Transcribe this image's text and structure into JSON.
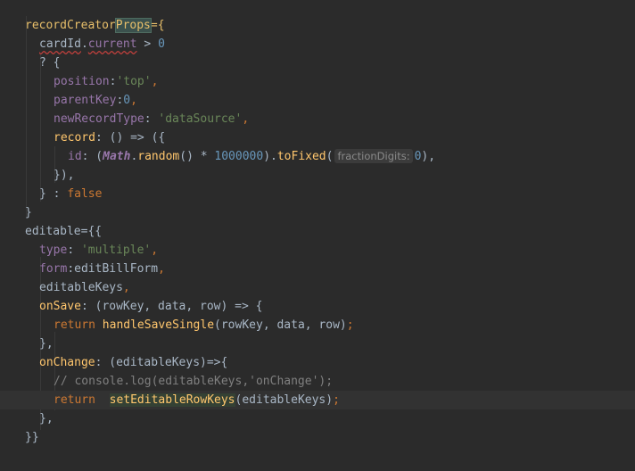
{
  "editor": {
    "colors": {
      "background": "#2b2b2b",
      "default": "#a9b7c6",
      "prop": "#9876aa",
      "string": "#6a8759",
      "number": "#6897bb",
      "keyword": "#cc7832",
      "function": "#ffc66d",
      "comment": "#808080",
      "tag": "#e8bf6a",
      "current_line": "#323232"
    },
    "lines": [
      {
        "indent": 1,
        "tokens": [
          {
            "t": "recordCreator",
            "s": "tag"
          },
          {
            "t": "Props",
            "s": "tag",
            "hl": "match"
          },
          {
            "t": "={",
            "s": "tag"
          }
        ]
      },
      {
        "indent": 2,
        "tokens": [
          {
            "t": "cardId",
            "s": "def",
            "ul": true
          },
          {
            "t": ".",
            "s": "def"
          },
          {
            "t": "current",
            "s": "prop",
            "ul": true
          },
          {
            "t": " > ",
            "s": "def"
          },
          {
            "t": "0",
            "s": "num"
          }
        ]
      },
      {
        "indent": 2,
        "tokens": [
          {
            "t": "? {",
            "s": "def"
          }
        ]
      },
      {
        "indent": 3,
        "tokens": [
          {
            "t": "position",
            "s": "prop"
          },
          {
            "t": ":",
            "s": "def"
          },
          {
            "t": "'top'",
            "s": "str"
          },
          {
            "t": ",",
            "s": "kw"
          }
        ]
      },
      {
        "indent": 3,
        "tokens": [
          {
            "t": "parentKey",
            "s": "prop"
          },
          {
            "t": ":",
            "s": "def"
          },
          {
            "t": "0",
            "s": "num"
          },
          {
            "t": ",",
            "s": "kw"
          }
        ]
      },
      {
        "indent": 3,
        "tokens": [
          {
            "t": "newRecordType",
            "s": "prop"
          },
          {
            "t": ": ",
            "s": "def"
          },
          {
            "t": "'dataSource'",
            "s": "str"
          },
          {
            "t": ",",
            "s": "kw"
          }
        ]
      },
      {
        "indent": 3,
        "tokens": [
          {
            "t": "record",
            "s": "fn"
          },
          {
            "t": ": () => ({",
            "s": "def"
          }
        ]
      },
      {
        "indent": 4,
        "tokens": [
          {
            "t": "id",
            "s": "prop"
          },
          {
            "t": ": (",
            "s": "def"
          },
          {
            "t": "Math",
            "s": "prop",
            "it": true
          },
          {
            "t": ".",
            "s": "def"
          },
          {
            "t": "random",
            "s": "fn"
          },
          {
            "t": "() * ",
            "s": "def"
          },
          {
            "t": "1000000",
            "s": "num"
          },
          {
            "t": ").",
            "s": "def"
          },
          {
            "t": "toFixed",
            "s": "fn"
          },
          {
            "t": "(",
            "s": "def"
          },
          {
            "t": "fractionDigits:",
            "s": "hint"
          },
          {
            "t": "0",
            "s": "num"
          },
          {
            "t": "),",
            "s": "def"
          }
        ]
      },
      {
        "indent": 3,
        "tokens": [
          {
            "t": "}),",
            "s": "def"
          }
        ]
      },
      {
        "indent": 2,
        "tokens": [
          {
            "t": "} : ",
            "s": "def"
          },
          {
            "t": "false",
            "s": "kw"
          }
        ]
      },
      {
        "indent": 1,
        "tokens": [
          {
            "t": "}",
            "s": "def"
          }
        ]
      },
      {
        "indent": 1,
        "tokens": [
          {
            "t": "editable",
            "s": "def"
          },
          {
            "t": "={{",
            "s": "def"
          }
        ]
      },
      {
        "indent": 2,
        "tokens": [
          {
            "t": "type",
            "s": "prop"
          },
          {
            "t": ": ",
            "s": "def"
          },
          {
            "t": "'multiple'",
            "s": "str"
          },
          {
            "t": ",",
            "s": "kw"
          }
        ]
      },
      {
        "indent": 2,
        "tokens": [
          {
            "t": "form",
            "s": "prop"
          },
          {
            "t": ":editBillForm",
            "s": "def"
          },
          {
            "t": ",",
            "s": "kw"
          }
        ]
      },
      {
        "indent": 2,
        "tokens": [
          {
            "t": "editableKeys",
            "s": "def"
          },
          {
            "t": ",",
            "s": "kw"
          }
        ]
      },
      {
        "indent": 2,
        "tokens": [
          {
            "t": "onSave",
            "s": "fn"
          },
          {
            "t": ": (rowKey, data, row) => {",
            "s": "def"
          }
        ]
      },
      {
        "indent": 3,
        "tokens": [
          {
            "t": "return ",
            "s": "kw"
          },
          {
            "t": "handleSaveSingle",
            "s": "fn"
          },
          {
            "t": "(rowKey, data, row)",
            "s": "def"
          },
          {
            "t": ";",
            "s": "kw"
          }
        ]
      },
      {
        "indent": 2,
        "tokens": [
          {
            "t": "},",
            "s": "def"
          }
        ]
      },
      {
        "indent": 2,
        "tokens": [
          {
            "t": "onChange",
            "s": "fn"
          },
          {
            "t": ": (editableKeys)=>{",
            "s": "def"
          }
        ]
      },
      {
        "indent": 3,
        "tokens": [
          {
            "t": "// console.log(editableKeys,'onChange');",
            "s": "cmt"
          }
        ]
      },
      {
        "indent": 3,
        "cur": true,
        "tokens": [
          {
            "t": "return  ",
            "s": "kw"
          },
          {
            "t": "setEditableRowKeys",
            "s": "fn",
            "hl": "usage"
          },
          {
            "t": "(editableKeys)",
            "s": "def"
          },
          {
            "t": ";",
            "s": "kw"
          }
        ]
      },
      {
        "indent": 2,
        "tokens": [
          {
            "t": "},",
            "s": "def"
          }
        ]
      },
      {
        "indent": 1,
        "tokens": [
          {
            "t": "}}",
            "s": "def"
          }
        ]
      },
      {
        "indent": 0,
        "tokens": []
      }
    ]
  }
}
